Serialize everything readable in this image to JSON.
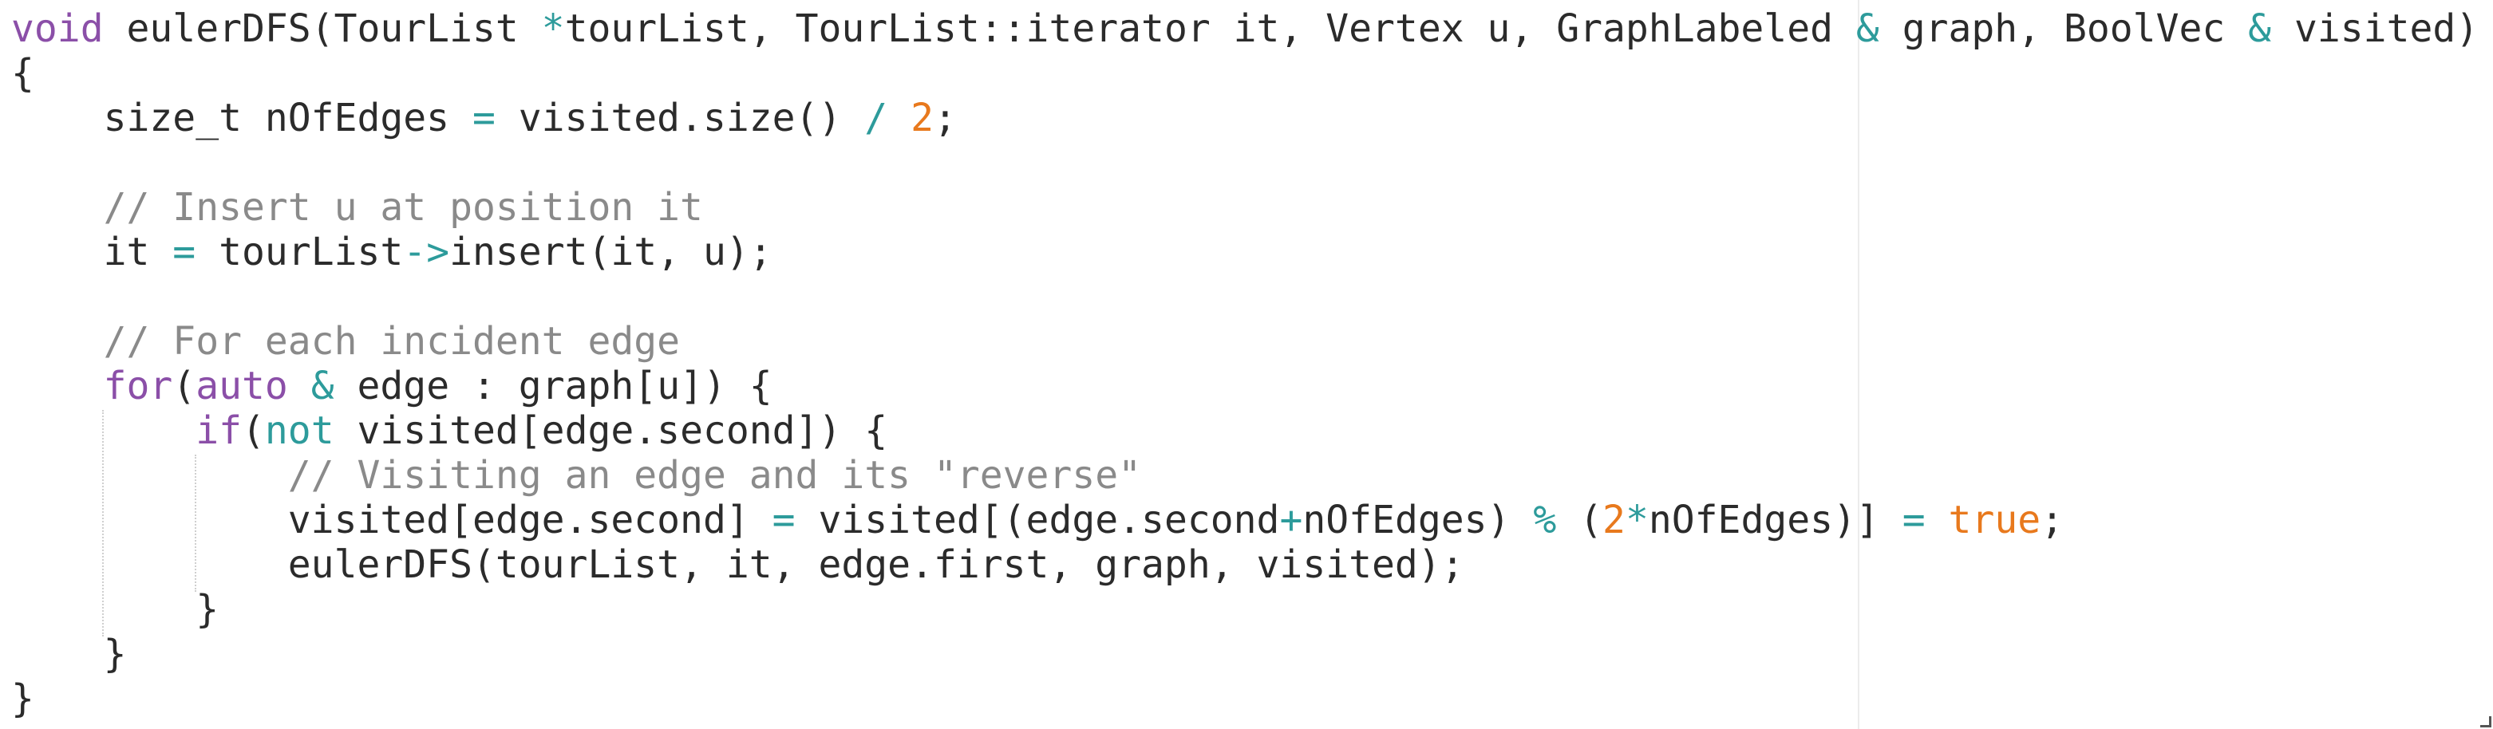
{
  "editor": {
    "lines": [
      {
        "indent": "",
        "tokens": [
          {
            "t": "void",
            "c": "kw"
          },
          {
            "t": " eulerDFS(TourList ",
            "c": "plain"
          },
          {
            "t": "*",
            "c": "op"
          },
          {
            "t": "tourList, TourList::iterator it, Vertex u, GraphLabeled ",
            "c": "plain"
          },
          {
            "t": "&",
            "c": "op"
          },
          {
            "t": " graph, BoolVec ",
            "c": "plain"
          },
          {
            "t": "&",
            "c": "op"
          },
          {
            "t": " visited)",
            "c": "plain"
          }
        ]
      },
      {
        "indent": "",
        "tokens": [
          {
            "t": "{",
            "c": "plain"
          }
        ]
      },
      {
        "indent": "    ",
        "tokens": [
          {
            "t": "size_t nOfEdges ",
            "c": "plain"
          },
          {
            "t": "=",
            "c": "op"
          },
          {
            "t": " visited.size() ",
            "c": "plain"
          },
          {
            "t": "/",
            "c": "op"
          },
          {
            "t": " ",
            "c": "plain"
          },
          {
            "t": "2",
            "c": "num"
          },
          {
            "t": ";",
            "c": "plain"
          }
        ]
      },
      {
        "indent": "",
        "tokens": []
      },
      {
        "indent": "    ",
        "tokens": [
          {
            "t": "// Insert u at position it",
            "c": "cm"
          }
        ]
      },
      {
        "indent": "    ",
        "tokens": [
          {
            "t": "it ",
            "c": "plain"
          },
          {
            "t": "=",
            "c": "op"
          },
          {
            "t": " tourList",
            "c": "plain"
          },
          {
            "t": "->",
            "c": "op"
          },
          {
            "t": "insert(it, u);",
            "c": "plain"
          }
        ]
      },
      {
        "indent": "",
        "tokens": []
      },
      {
        "indent": "    ",
        "tokens": [
          {
            "t": "// For each incident edge",
            "c": "cm"
          }
        ]
      },
      {
        "indent": "    ",
        "tokens": [
          {
            "t": "for",
            "c": "kw"
          },
          {
            "t": "(",
            "c": "plain"
          },
          {
            "t": "auto",
            "c": "kw"
          },
          {
            "t": " ",
            "c": "plain"
          },
          {
            "t": "&",
            "c": "op"
          },
          {
            "t": " edge : graph[u]) {",
            "c": "plain"
          }
        ]
      },
      {
        "indent": "        ",
        "tokens": [
          {
            "t": "if",
            "c": "kw"
          },
          {
            "t": "(",
            "c": "plain"
          },
          {
            "t": "not",
            "c": "op"
          },
          {
            "t": " visited[edge.second]) {",
            "c": "plain"
          }
        ]
      },
      {
        "indent": "            ",
        "tokens": [
          {
            "t": "// Visiting an edge and its \"reverse\"",
            "c": "cm"
          }
        ]
      },
      {
        "indent": "            ",
        "tokens": [
          {
            "t": "visited[edge.second] ",
            "c": "plain"
          },
          {
            "t": "=",
            "c": "op"
          },
          {
            "t": " visited[(edge.second",
            "c": "plain"
          },
          {
            "t": "+",
            "c": "op"
          },
          {
            "t": "nOfEdges) ",
            "c": "plain"
          },
          {
            "t": "%",
            "c": "op"
          },
          {
            "t": " (",
            "c": "plain"
          },
          {
            "t": "2",
            "c": "num"
          },
          {
            "t": "*",
            "c": "op"
          },
          {
            "t": "nOfEdges)] ",
            "c": "plain"
          },
          {
            "t": "=",
            "c": "op"
          },
          {
            "t": " ",
            "c": "plain"
          },
          {
            "t": "true",
            "c": "num"
          },
          {
            "t": ";",
            "c": "plain"
          }
        ]
      },
      {
        "indent": "            ",
        "tokens": [
          {
            "t": "eulerDFS(tourList, it, edge.first, graph, visited);",
            "c": "plain"
          }
        ]
      },
      {
        "indent": "        ",
        "tokens": [
          {
            "t": "}",
            "c": "plain"
          }
        ]
      },
      {
        "indent": "    ",
        "tokens": [
          {
            "t": "}",
            "c": "plain"
          }
        ]
      },
      {
        "indent": "",
        "tokens": [
          {
            "t": "}",
            "c": "plain"
          }
        ]
      }
    ]
  },
  "colors": {
    "keyword": "#8b4fa8",
    "operator": "#2d9b9b",
    "number": "#e8791d",
    "comment": "#8a8a8a",
    "text": "#2b2b2b"
  }
}
